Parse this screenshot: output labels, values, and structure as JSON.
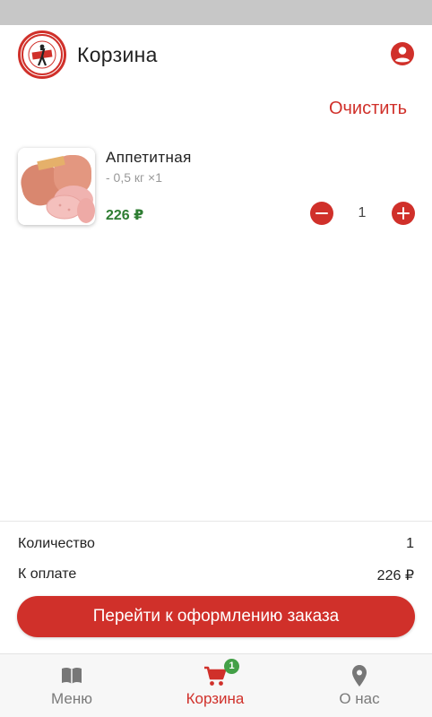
{
  "header": {
    "title": "Корзина",
    "profile_icon": "account-circle-icon"
  },
  "actions": {
    "clear_label": "Очистить"
  },
  "cart": {
    "items": [
      {
        "name": "Аппетитная",
        "meta": "- 0,5 кг ×1",
        "price": "226 ₽",
        "quantity": "1"
      }
    ]
  },
  "summary": {
    "quantity_label": "Количество",
    "quantity_value": "1",
    "total_label": "К оплате",
    "total_value": "226 ₽",
    "checkout_label": "Перейти к оформлению заказа"
  },
  "nav": {
    "items": [
      {
        "label": "Меню",
        "icon": "book-icon"
      },
      {
        "label": "Корзина",
        "icon": "cart-icon",
        "badge": "1"
      },
      {
        "label": "О нас",
        "icon": "location-pin-icon"
      }
    ]
  },
  "colors": {
    "accent": "#d0302a",
    "price": "#2e7d32",
    "badge": "#43a047"
  }
}
